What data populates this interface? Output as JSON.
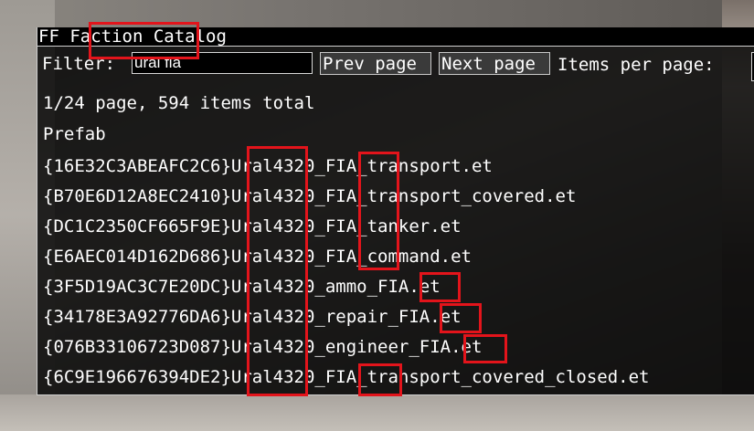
{
  "window": {
    "title": "FF Faction Catalog"
  },
  "toolbar": {
    "filter_label": "Filter:",
    "filter_value": "ural fia",
    "prev_label": "Prev page",
    "next_label": "Next page",
    "items_per_page_label": "Items per page:"
  },
  "status": {
    "page_info": "1/24 page, 594 items total"
  },
  "list": {
    "column_header": "Prefab",
    "items": [
      "{16E32C3ABEAFC2C6}Ural4320_FIA_transport.et",
      "{B70E6D12A8EC2410}Ural4320_FIA_transport_covered.et",
      "{DC1C2350CF665F9E}Ural4320_FIA_tanker.et",
      "{E6AEC014D162D686}Ural4320_FIA_command.et",
      "{3F5D19AC3C7E20DC}Ural4320_ammo_FIA.et",
      "{34178E3A92776DA6}Ural4320_repair_FIA.et",
      "{076B33106723D087}Ural4320_engineer_FIA.et",
      "{6C9E196676394DE2}Ural4320_FIA_transport_covered_closed.et"
    ]
  },
  "colors": {
    "highlight": "#e3141b",
    "panel_bg": "#000000",
    "text": "#ffffff"
  }
}
